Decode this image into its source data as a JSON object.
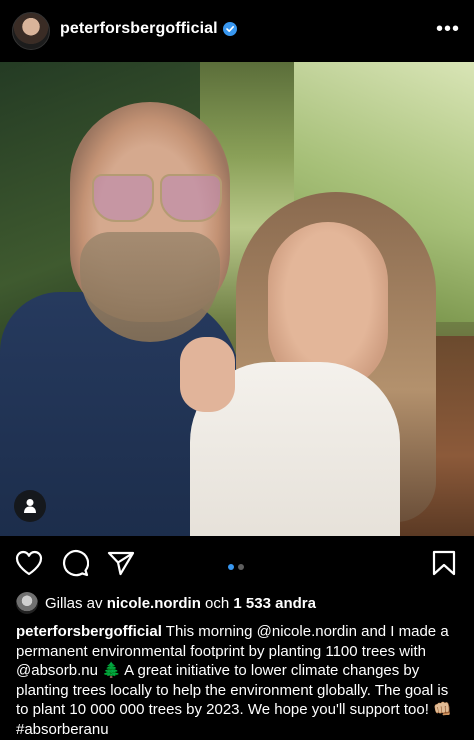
{
  "header": {
    "username": "peterforsbergofficial",
    "verified": true,
    "more_icon": "more-horizontal-icon"
  },
  "post": {
    "image_description_icon": "person-tag-icon",
    "carousel": {
      "count": 2,
      "active": 0,
      "active_color": "#3897f0",
      "inactive_color": "#5e5e5e"
    }
  },
  "actions": {
    "like_icon": "heart-icon",
    "comment_icon": "comment-icon",
    "share_icon": "send-icon",
    "save_icon": "bookmark-icon"
  },
  "likes": {
    "prefix": "Gillas av",
    "user": "nicole.nordin",
    "conjunction": "och",
    "count": "1 533 andra"
  },
  "caption": {
    "username": "peterforsbergofficial",
    "text": "This morning @nicole.nordin and I made a permanent environmental footprint by planting 1100 trees with @absorb.nu 🌲 A great initiative to lower climate changes by planting trees locally to help the environment globally. The goal is to plant 10 000 000 trees by 2023. We hope you'll support too! 👊🏼 #absorberanu"
  }
}
